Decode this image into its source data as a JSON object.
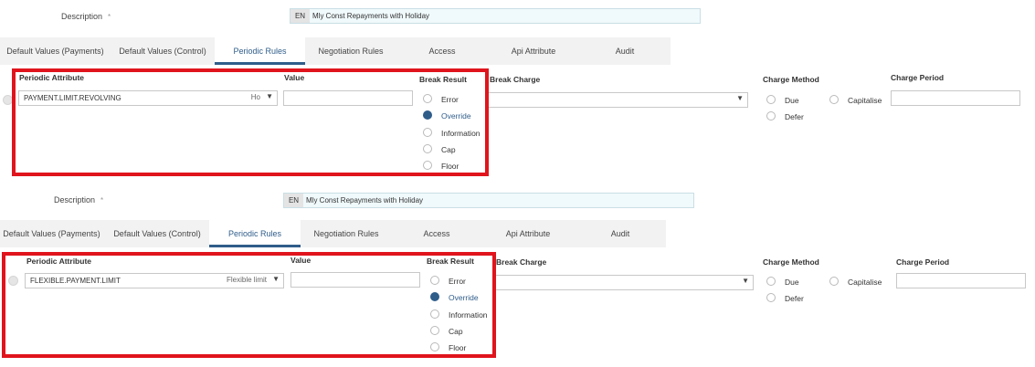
{
  "panels": [
    {
      "description": {
        "label": "Description",
        "required_mark": "*",
        "lang": "EN",
        "value": "Mly Const Repayments with Holiday"
      },
      "tabs": [
        {
          "label": "Default Values (Payments)"
        },
        {
          "label": "Default Values (Control)"
        },
        {
          "label": "Periodic Rules"
        },
        {
          "label": "Negotiation Rules"
        },
        {
          "label": "Access"
        },
        {
          "label": "Api Attribute"
        },
        {
          "label": "Audit"
        }
      ],
      "active_tab": "Periodic Rules",
      "headers": {
        "periodic_attribute": "Periodic Attribute",
        "value": "Value",
        "break_result": "Break Result",
        "break_charge": "Break Charge",
        "charge_method": "Charge Method",
        "charge_period": "Charge Period"
      },
      "periodic_attribute": {
        "value": "PAYMENT.LIMIT.REVOLVING",
        "hint": "Ho"
      },
      "value_field": "",
      "break_result_options": [
        "Error",
        "Override",
        "Information",
        "Cap",
        "Floor"
      ],
      "break_result_selected": "Override",
      "break_charge": "",
      "charge_method_options": [
        "Due",
        "Defer"
      ],
      "charge_method_extra": "Capitalise",
      "charge_period": ""
    },
    {
      "description": {
        "label": "Description",
        "required_mark": "*",
        "lang": "EN",
        "value": "Mly Const Repayments with Holiday"
      },
      "tabs": [
        {
          "label": "Default Values (Payments)"
        },
        {
          "label": "Default Values (Control)"
        },
        {
          "label": "Periodic Rules"
        },
        {
          "label": "Negotiation Rules"
        },
        {
          "label": "Access"
        },
        {
          "label": "Api Attribute"
        },
        {
          "label": "Audit"
        }
      ],
      "active_tab": "Periodic Rules",
      "headers": {
        "periodic_attribute": "Periodic Attribute",
        "value": "Value",
        "break_result": "Break Result",
        "break_charge": "Break Charge",
        "charge_method": "Charge Method",
        "charge_period": "Charge Period"
      },
      "periodic_attribute": {
        "value": "FLEXIBLE.PAYMENT.LIMIT",
        "hint": "Flexible limit"
      },
      "value_field": "",
      "break_result_options": [
        "Error",
        "Override",
        "Information",
        "Cap",
        "Floor"
      ],
      "break_result_selected": "Override",
      "break_charge": "",
      "charge_method_options": [
        "Due",
        "Defer"
      ],
      "charge_method_extra": "Capitalise",
      "charge_period": ""
    }
  ],
  "icons": {
    "dropdown": "chevron-down-icon",
    "add_row": "add-row-icon"
  },
  "colors": {
    "accent": "#2f5d8a",
    "highlight_box": "#e0141c",
    "desc_bg": "#f0f9fb",
    "tabbar_bg": "#f2f2f2"
  }
}
